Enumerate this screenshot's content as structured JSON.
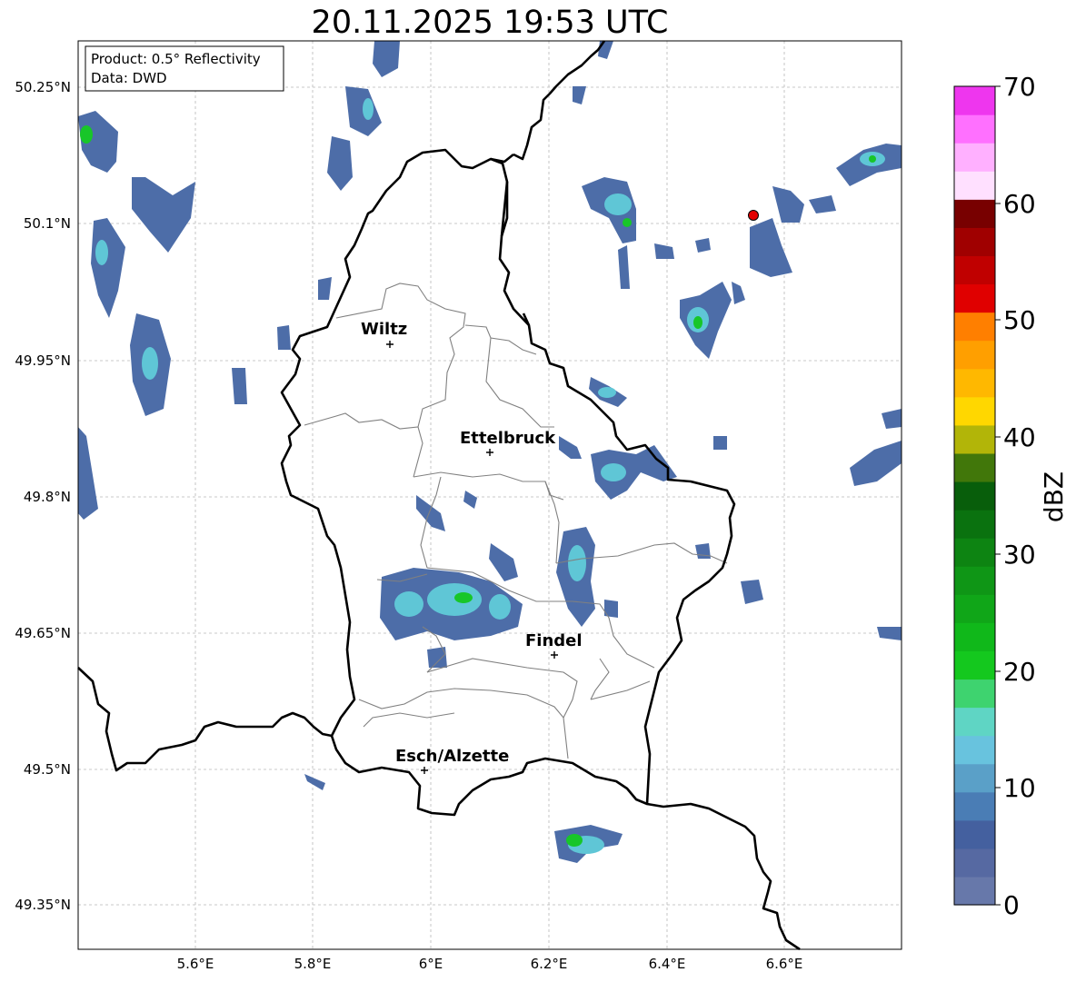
{
  "title": "20.11.2025 19:53 UTC",
  "info_box": {
    "product": "Product: 0.5° Reflectivity",
    "data": "Data: DWD"
  },
  "map": {
    "lat_ticks": [
      "50.25°N",
      "50.1°N",
      "49.95°N",
      "49.8°N",
      "49.65°N",
      "49.5°N",
      "49.35°N"
    ],
    "lon_ticks": [
      "5.6°E",
      "5.8°E",
      "6°E",
      "6.2°E",
      "6.4°E",
      "6.6°E"
    ],
    "cities": [
      {
        "name": "Wiltz"
      },
      {
        "name": "Ettelbruck"
      },
      {
        "name": "Findel"
      },
      {
        "name": "Esch/Alzette"
      }
    ],
    "radar_site_marker_color": "#e30000",
    "border_color": "#000000",
    "canton_line_color": "#808080",
    "grid": true
  },
  "colorbar": {
    "label": "dBZ",
    "ticks": [
      "0",
      "10",
      "20",
      "30",
      "40",
      "50",
      "60",
      "70"
    ],
    "colors": [
      "#6778aa",
      "#5669a2",
      "#44609f",
      "#4a7db5",
      "#5aa0c8",
      "#68c3de",
      "#5fd5c4",
      "#3ed36f",
      "#14c81e",
      "#10b81a",
      "#10a618",
      "#0f9616",
      "#0d8412",
      "#0a720f",
      "#085e0b",
      "#41770a",
      "#b2b508",
      "#ffd700",
      "#ffb800",
      "#ff9f00",
      "#ff7f00",
      "#e00000",
      "#c00000",
      "#a00000",
      "#780000",
      "#ffe0ff",
      "#ffb0ff",
      "#ff70ff",
      "#ee36ee"
    ]
  }
}
